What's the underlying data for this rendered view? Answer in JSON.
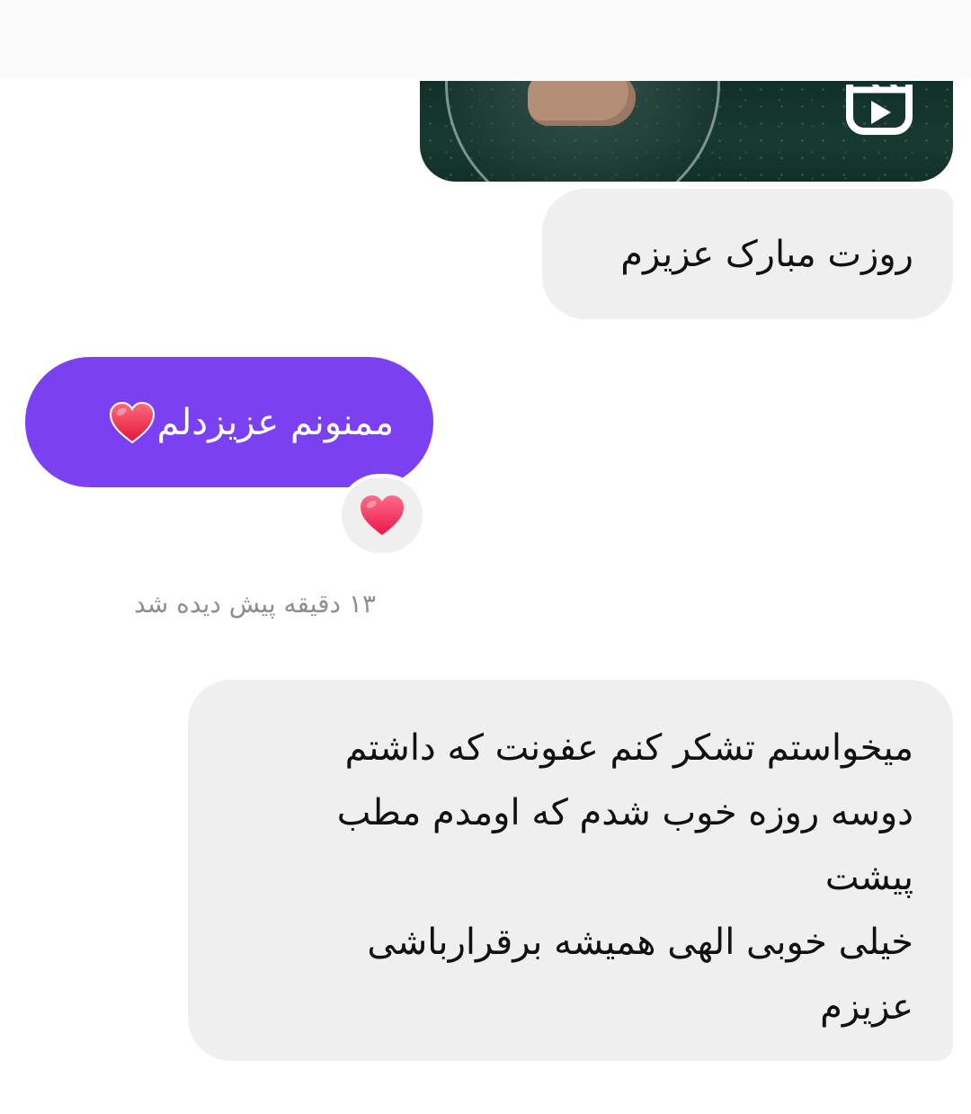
{
  "thread": {
    "shared_reel": {
      "icon": "reels-icon"
    },
    "messages": [
      {
        "direction": "incoming",
        "text": "روزت مبارک عزیزم"
      },
      {
        "direction": "outgoing",
        "text": "ممنونم عزیزدلم",
        "emoji_icon": "red-heart-icon"
      },
      {
        "direction": "incoming",
        "lines": [
          "میخواستم تشکر کنم عفونت که داشتم",
          "دوسه روزه خوب شدم که اومدم مطب",
          "پیشت",
          "خیلی خوبی الهی همیشه برقرارباشی",
          "عزیزم"
        ]
      }
    ],
    "reaction": {
      "icon": "red-heart-icon"
    },
    "seen_status": "۱۳ دقیقه پیش دیده شد"
  },
  "colors": {
    "outgoing_bubble": "#7b40f2",
    "incoming_bubble": "#efefef",
    "seen_text": "#8e8e8e"
  }
}
